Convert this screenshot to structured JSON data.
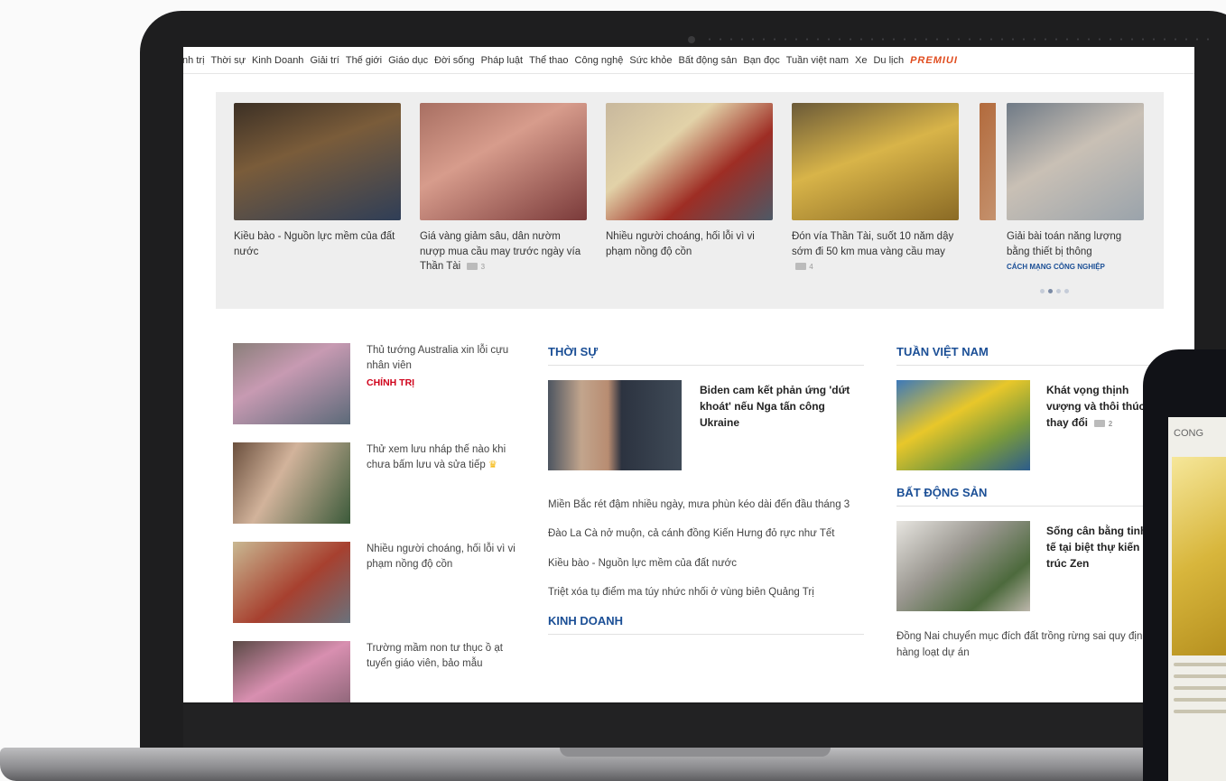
{
  "nav": {
    "items": [
      "ính trị",
      "Thời sự",
      "Kinh Doanh",
      "Giải trí",
      "Thế giới",
      "Giáo dục",
      "Đời sống",
      "Pháp luật",
      "Thể thao",
      "Công nghệ",
      "Sức khỏe",
      "Bất động sản",
      "Bạn đọc",
      "Tuần việt nam",
      "Xe",
      "Du lịch"
    ],
    "premium": "PREMIUI"
  },
  "carousel": {
    "items": [
      {
        "text": "Kiều bào - Nguồn lực mềm của đất nước",
        "comments": ""
      },
      {
        "text": "Giá vàng giảm sâu, dân nườm nượp mua cầu may trước ngày vía Thần Tài",
        "comments": "3"
      },
      {
        "text": "Nhiều người choáng, hối lỗi vì vi phạm nồng độ cồn",
        "comments": ""
      },
      {
        "text": "Đón vía Thần Tài, suốt 10 năm dậy sớm đi 50 km mua vàng cầu may",
        "comments": "4"
      },
      {
        "text": "Giải bài toán năng lượng bằng thiết bị thông",
        "category": "CÁCH MẠNG CÔNG NGHIỆP"
      }
    ]
  },
  "left": {
    "items": [
      {
        "text": "Thủ tướng Australia xin lỗi cựu nhân viên",
        "category": "CHÍNH TRỊ"
      },
      {
        "text": "Thử xem lưu nháp thế nào khi chưa bấm lưu và sửa tiếp",
        "category": ""
      },
      {
        "text": "Nhiều người choáng, hối lỗi vì vi phạm nồng độ cồn",
        "category": ""
      },
      {
        "text": "Trường mầm non tư thục ồ ạt tuyển giáo viên, bảo mẫu",
        "category": ""
      }
    ]
  },
  "mid": {
    "heading": "THỜI SỰ",
    "feature_title": "Biden cam kết phản ứng 'dứt khoát' nếu Nga tấn công Ukraine",
    "links": [
      "Miền Bắc rét đậm nhiều ngày, mưa phùn kéo dài đến đầu tháng 3",
      "Đào La Cà nở muộn, cả cánh đồng Kiến Hưng đỏ rực như Tết",
      "Kiều bào - Nguồn lực mềm của đất nước",
      "Triệt xóa tụ điểm ma túy nhức nhối ở vùng biên Quảng Trị"
    ],
    "heading2": "KINH DOANH"
  },
  "right": {
    "heading": "TUẦN VIỆT NAM",
    "feature1_title": "Khát vọng thịnh vượng và thôi thúc thay đổi",
    "feature1_comments": "2",
    "heading2": "BẤT ĐỘNG SẢN",
    "feature2_title": "Sống cân bằng tinh tế tại biệt thự kiến trúc Zen",
    "link": "Đồng Nai chuyển mục đích đất trồng rừng sai quy định ở hàng loạt dự án"
  },
  "phone": {
    "title": "CONG"
  },
  "colors": {
    "accent": "#1b4f96",
    "category_red": "#d0021b",
    "premium": "#e04b1d"
  }
}
